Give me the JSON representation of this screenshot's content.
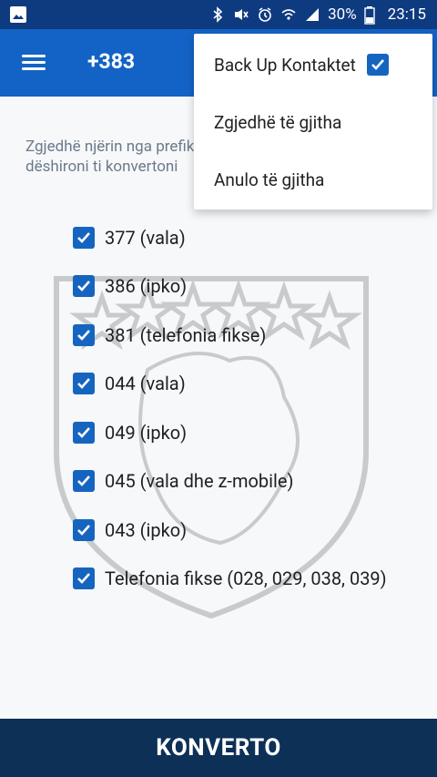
{
  "status_bar": {
    "battery_percent": "30%",
    "time": "23:15",
    "icons": [
      "image-icon",
      "bluetooth-icon",
      "mute-icon",
      "alarm-icon",
      "wifi-icon",
      "signal-icon",
      "battery-icon"
    ]
  },
  "app_bar": {
    "title": "+383",
    "menu_icon": "hamburger-menu-icon"
  },
  "content": {
    "description": "Zgjedhë njërin nga prefikset e mëposhtme cilin/et dëshironi ti konvertoni",
    "options": [
      {
        "label": "377 (vala)",
        "checked": true
      },
      {
        "label": "386 (ipko)",
        "checked": true
      },
      {
        "label": "381 (telefonia fikse)",
        "checked": true
      },
      {
        "label": "044 (vala)",
        "checked": true
      },
      {
        "label": "049 (ipko)",
        "checked": true
      },
      {
        "label": "045 (vala dhe z-mobile)",
        "checked": true
      },
      {
        "label": "043 (ipko)",
        "checked": true
      },
      {
        "label": "Telefonia fikse (028, 029, 038, 039)",
        "checked": true
      }
    ]
  },
  "overflow_menu": {
    "item1": "Back Up Kontaktet",
    "item1_checked": true,
    "item2": "Zgjedhë të gjitha",
    "item3": "Anulo të gjitha"
  },
  "footer": {
    "button_label": "KONVERTO"
  },
  "colors": {
    "status_bar": "#0e3a80",
    "app_bar": "#1363c6",
    "checkbox": "#1565c0",
    "footer": "#0d3057",
    "description_text": "#6b7a8a"
  }
}
